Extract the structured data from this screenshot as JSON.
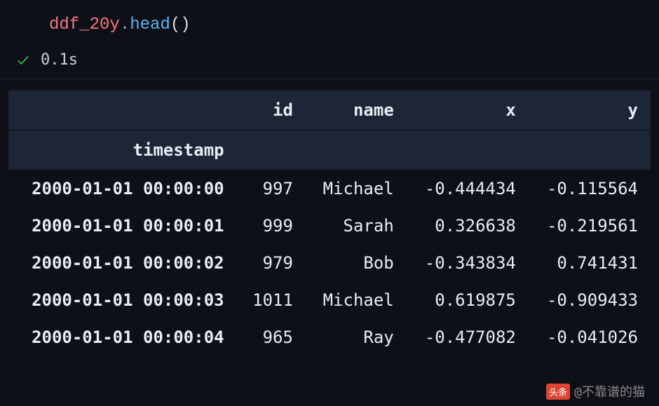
{
  "code": {
    "variable": "ddf_20y",
    "dot": ".",
    "method": "head",
    "open_paren": "(",
    "close_paren": ")"
  },
  "status": {
    "time": "0.1s"
  },
  "table": {
    "columns": [
      "id",
      "name",
      "x",
      "y"
    ],
    "index_name": "timestamp",
    "rows": [
      {
        "index": "2000-01-01 00:00:00",
        "id": "997",
        "name": "Michael",
        "x": "-0.444434",
        "y": "-0.115564"
      },
      {
        "index": "2000-01-01 00:00:01",
        "id": "999",
        "name": "Sarah",
        "x": "0.326638",
        "y": "-0.219561"
      },
      {
        "index": "2000-01-01 00:00:02",
        "id": "979",
        "name": "Bob",
        "x": "-0.343834",
        "y": "0.741431"
      },
      {
        "index": "2000-01-01 00:00:03",
        "id": "1011",
        "name": "Michael",
        "x": "0.619875",
        "y": "-0.909433"
      },
      {
        "index": "2000-01-01 00:00:04",
        "id": "965",
        "name": "Ray",
        "x": "-0.477082",
        "y": "-0.041026"
      }
    ]
  },
  "watermark": {
    "logo": "头条",
    "text": "@不靠谱的猫"
  }
}
